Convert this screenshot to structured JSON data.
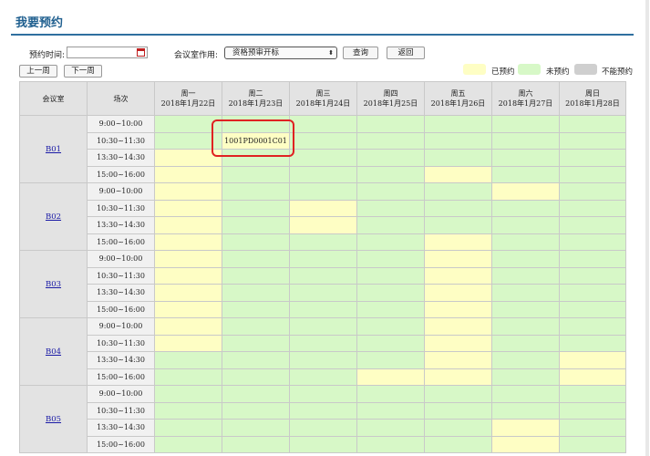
{
  "page": {
    "title": "我要预约"
  },
  "filters": {
    "date_label": "预约时间:",
    "date_value": "",
    "purpose_label": "会议室作用:",
    "purpose_selected": "资格预审开标",
    "query_label": "查询",
    "back_label": "返回",
    "prev_week_label": "上一周",
    "next_week_label": "下一周"
  },
  "legend": {
    "booked": {
      "label": "已预约",
      "color": "#fefec4"
    },
    "free": {
      "label": "未预约",
      "color": "#d7f8c7"
    },
    "unavailable": {
      "label": "不能预约",
      "color": "#cfcfcf"
    }
  },
  "table": {
    "room_header": "会议室",
    "slot_header": "场次",
    "days": [
      {
        "weekday": "周一",
        "date": "2018年1月22日"
      },
      {
        "weekday": "周二",
        "date": "2018年1月23日"
      },
      {
        "weekday": "周三",
        "date": "2018年1月24日"
      },
      {
        "weekday": "周四",
        "date": "2018年1月25日"
      },
      {
        "weekday": "周五",
        "date": "2018年1月26日"
      },
      {
        "weekday": "周六",
        "date": "2018年1月27日"
      },
      {
        "weekday": "周日",
        "date": "2018年1月28日"
      }
    ],
    "rooms": [
      {
        "name": "B01",
        "slots": [
          {
            "time": "9:00~10:00",
            "cells": [
              "free",
              "free",
              "free",
              "free",
              "free",
              "free",
              "free"
            ]
          },
          {
            "time": "10:30~11:30",
            "cells": [
              "free",
              "booked",
              "free",
              "free",
              "free",
              "free",
              "free"
            ],
            "labels": [
              "",
              "1001PD0001C01",
              "",
              "",
              "",
              "",
              ""
            ]
          },
          {
            "time": "13:30~14:30",
            "cells": [
              "booked",
              "free",
              "free",
              "free",
              "free",
              "free",
              "free"
            ]
          },
          {
            "time": "15:00~16:00",
            "cells": [
              "booked",
              "free",
              "free",
              "free",
              "booked",
              "free",
              "free"
            ]
          }
        ]
      },
      {
        "name": "B02",
        "slots": [
          {
            "time": "9:00~10:00",
            "cells": [
              "booked",
              "free",
              "free",
              "free",
              "free",
              "booked",
              "free"
            ]
          },
          {
            "time": "10:30~11:30",
            "cells": [
              "booked",
              "free",
              "booked",
              "free",
              "free",
              "free",
              "free"
            ]
          },
          {
            "time": "13:30~14:30",
            "cells": [
              "booked",
              "free",
              "booked",
              "free",
              "free",
              "free",
              "free"
            ]
          },
          {
            "time": "15:00~16:00",
            "cells": [
              "booked",
              "free",
              "free",
              "free",
              "booked",
              "free",
              "free"
            ]
          }
        ]
      },
      {
        "name": "B03",
        "slots": [
          {
            "time": "9:00~10:00",
            "cells": [
              "booked",
              "free",
              "free",
              "free",
              "booked",
              "free",
              "free"
            ]
          },
          {
            "time": "10:30~11:30",
            "cells": [
              "booked",
              "free",
              "free",
              "free",
              "booked",
              "free",
              "free"
            ]
          },
          {
            "time": "13:30~14:30",
            "cells": [
              "booked",
              "free",
              "free",
              "free",
              "booked",
              "free",
              "free"
            ]
          },
          {
            "time": "15:00~16:00",
            "cells": [
              "booked",
              "free",
              "free",
              "free",
              "booked",
              "free",
              "free"
            ]
          }
        ]
      },
      {
        "name": "B04",
        "slots": [
          {
            "time": "9:00~10:00",
            "cells": [
              "booked",
              "free",
              "free",
              "free",
              "booked",
              "free",
              "free"
            ]
          },
          {
            "time": "10:30~11:30",
            "cells": [
              "booked",
              "free",
              "free",
              "free",
              "booked",
              "free",
              "free"
            ]
          },
          {
            "time": "13:30~14:30",
            "cells": [
              "free",
              "free",
              "free",
              "free",
              "booked",
              "free",
              "booked"
            ]
          },
          {
            "time": "15:00~16:00",
            "cells": [
              "free",
              "free",
              "free",
              "booked",
              "booked",
              "free",
              "booked"
            ]
          }
        ]
      },
      {
        "name": "B05",
        "slots": [
          {
            "time": "9:00~10:00",
            "cells": [
              "free",
              "free",
              "free",
              "free",
              "free",
              "free",
              "free"
            ]
          },
          {
            "time": "10:30~11:30",
            "cells": [
              "free",
              "free",
              "free",
              "free",
              "free",
              "free",
              "free"
            ]
          },
          {
            "time": "13:30~14:30",
            "cells": [
              "free",
              "free",
              "free",
              "free",
              "free",
              "booked",
              "free"
            ]
          },
          {
            "time": "15:00~16:00",
            "cells": [
              "free",
              "free",
              "free",
              "free",
              "free",
              "booked",
              "free"
            ]
          }
        ]
      }
    ]
  }
}
